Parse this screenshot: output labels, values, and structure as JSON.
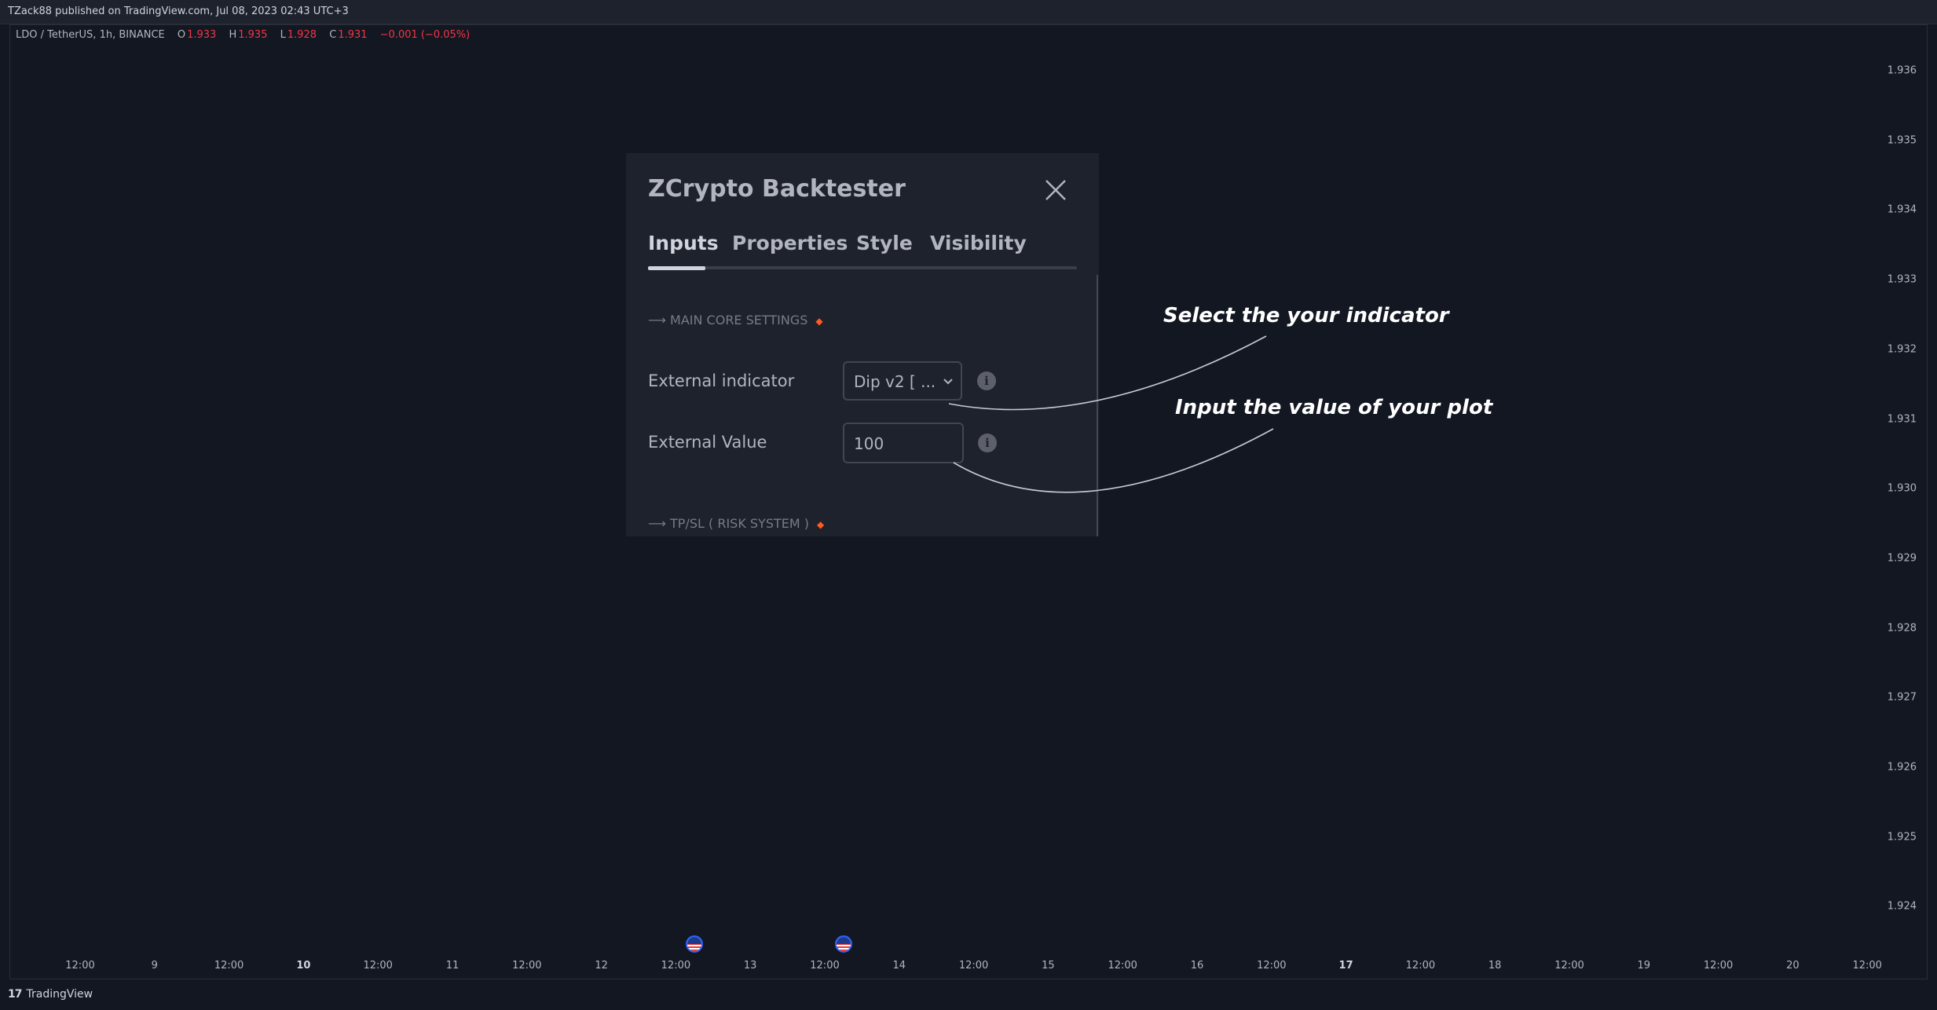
{
  "header": {
    "published": "TZack88 published on TradingView.com, Jul 08, 2023 02:43 UTC+3"
  },
  "legend": {
    "symbol": "LDO / TetherUS, 1h, BINANCE",
    "o_label": "O",
    "o_value": "1.933",
    "h_label": "H",
    "h_value": "1.935",
    "l_label": "L",
    "l_value": "1.928",
    "c_label": "C",
    "c_value": "1.931",
    "change": "−0.001 (−0.05%)"
  },
  "price_axis": [
    "1.936",
    "1.935",
    "1.934",
    "1.933",
    "1.932",
    "1.931",
    "1.930",
    "1.929",
    "1.928",
    "1.927",
    "1.926",
    "1.925",
    "1.924"
  ],
  "time_axis": [
    {
      "label": "12:00",
      "bold": false
    },
    {
      "label": "9",
      "bold": false
    },
    {
      "label": "12:00",
      "bold": false
    },
    {
      "label": "10",
      "bold": true
    },
    {
      "label": "12:00",
      "bold": false
    },
    {
      "label": "11",
      "bold": false
    },
    {
      "label": "12:00",
      "bold": false
    },
    {
      "label": "12",
      "bold": false
    },
    {
      "label": "12:00",
      "bold": false
    },
    {
      "label": "13",
      "bold": false
    },
    {
      "label": "12:00",
      "bold": false
    },
    {
      "label": "14",
      "bold": false
    },
    {
      "label": "12:00",
      "bold": false
    },
    {
      "label": "15",
      "bold": false
    },
    {
      "label": "12:00",
      "bold": false
    },
    {
      "label": "16",
      "bold": false
    },
    {
      "label": "12:00",
      "bold": false
    },
    {
      "label": "17",
      "bold": true
    },
    {
      "label": "12:00",
      "bold": false
    },
    {
      "label": "18",
      "bold": false
    },
    {
      "label": "12:00",
      "bold": false
    },
    {
      "label": "19",
      "bold": false
    },
    {
      "label": "12:00",
      "bold": false
    },
    {
      "label": "20",
      "bold": false
    },
    {
      "label": "12:00",
      "bold": false
    }
  ],
  "dialog": {
    "title": "ZCrypto Backtester",
    "tabs": [
      "Inputs",
      "Properties",
      "Style",
      "Visibility"
    ],
    "active_tab": "Inputs",
    "section_main": "⟶ MAIN CORE SETTINGS",
    "section_tpsl": "⟶ TP/SL ( RISK SYSTEM )",
    "external_indicator_label": "External indicator",
    "external_indicator_value": "Dip v2 [ ...",
    "external_value_label": "External Value",
    "external_value_value": "100",
    "info_glyph": "i"
  },
  "annotations": {
    "select": "Select the your indicator",
    "input": "Input the value of your plot"
  },
  "footer": {
    "logo_text": "TradingView",
    "logo_mark": "17"
  },
  "colors": {
    "background": "#131722",
    "dialog": "#1e222d",
    "negative": "#f23645",
    "section_dot": "#ff5a1f"
  },
  "icons": [
    "close-icon",
    "chevron-down-icon",
    "info-icon",
    "us-flag-icon",
    "tradingview-logo-icon"
  ]
}
